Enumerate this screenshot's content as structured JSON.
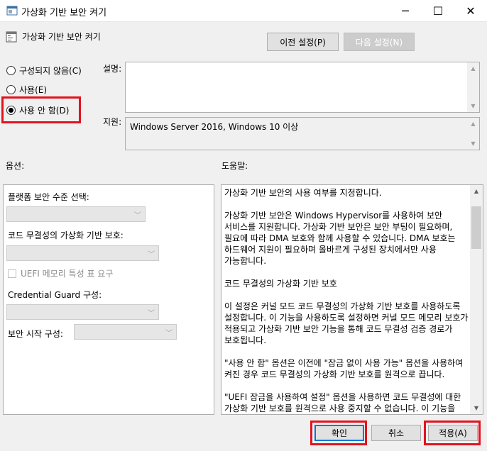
{
  "window": {
    "title": "가상화 기반 보안 켜기",
    "controls": {
      "minimize": "─",
      "maximize": "☐",
      "close": "✕"
    }
  },
  "header": {
    "policy_title": "가상화 기반 보안 켜기",
    "prev_button": "이전 설정(P)",
    "next_button": "다음 설정(N)"
  },
  "state_options": [
    {
      "label": "구성되지 않음(C)",
      "checked": false
    },
    {
      "label": "사용(E)",
      "checked": false
    },
    {
      "label": "사용 안 함(D)",
      "checked": true
    }
  ],
  "labels": {
    "description": "설명:",
    "supported_on": "지원:",
    "options": "옵션:",
    "help": "도움말:"
  },
  "supported_on_value": "Windows Server 2016, Windows 10 이상",
  "options_panel": {
    "platform_label": "플랫폼 보안 수준 선택:",
    "cidp_label": "코드 무결성의 가상화 기반 보호:",
    "uefi_label": "UEFI 메모리 특성 표 요구",
    "credential_guard_label": "Credential  Guard 구성:",
    "secure_launch_label": "보안 시작 구성:"
  },
  "help_paragraphs": [
    "가상화 기반 보안의 사용 여부를 지정합니다.",
    "가상화 기반 보안은 Windows Hypervisor를 사용하여 보안 서비스를 지원합니다. 가상화 기반 보안은 보안 부팅이 필요하며, 필요에 따라 DMA 보호와 함께 사용할 수 있습니다. DMA 보호는 하드웨어 지원이 필요하며 올바르게 구성된 장치에서만 사용 가능합니다.",
    "코드 무결성의 가상화 기반 보호",
    "이 설정은 커널 모드 코드 무결성의 가상화 기반 보호를 사용하도록 설정합니다. 이 기능을 사용하도록 설정하면 커널 모드 메모리 보호가 적용되고 가상화 기반 보안 기능을 통해 코드 무결성 검증 경로가 보호됩니다.",
    "\"사용 안 함\" 옵션은 이전에 \"잠금 없이 사용 가능\" 옵션을 사용하여 켜진 경우 코드 무결성의 가상화 기반 보호를 원격으로 끕니다.",
    "\"UEFI 잠금을 사용하여 설정\" 옵션을 사용하면 코드 무결성에 대한 가상화 기반 보호를 원격으로 사용 중지할 수 없습니다. 이 기능을 사용하지 않도록 설정하려면 그룹 정책을 \"사용 안 함\"으로"
  ],
  "buttons": {
    "ok": "확인",
    "cancel": "취소",
    "apply": "적용(A)"
  },
  "colors": {
    "highlight_red": "#e3131e",
    "focus_blue": "#0078d7"
  }
}
